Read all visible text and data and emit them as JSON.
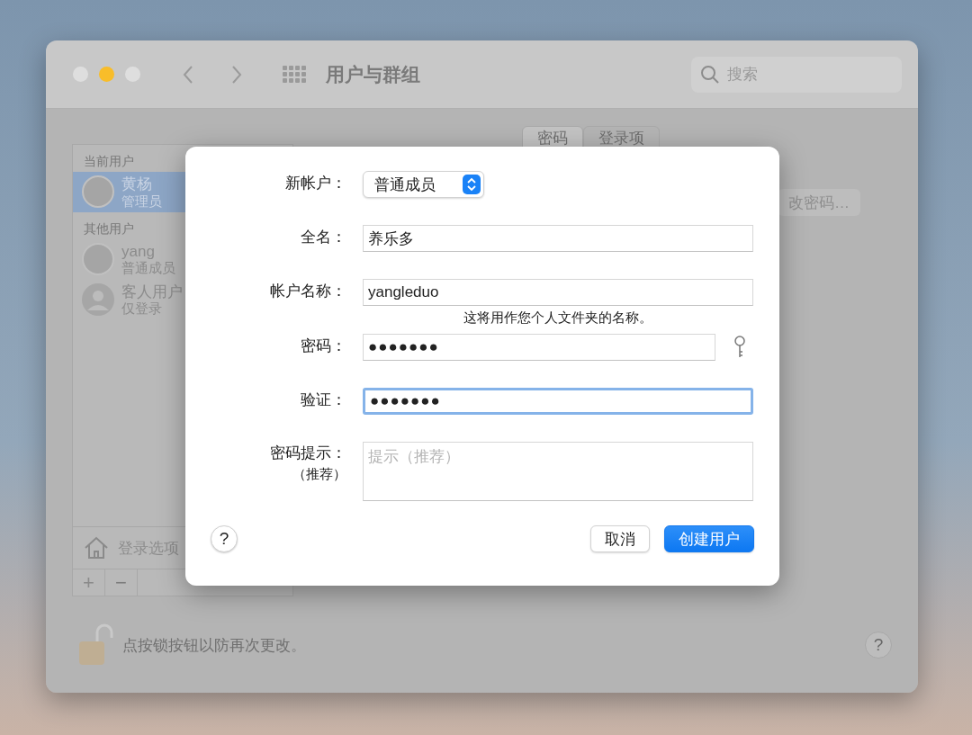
{
  "window": {
    "title": "用户与群组",
    "search": {
      "placeholder": "搜索"
    }
  },
  "sidebar": {
    "sections": [
      {
        "heading": "当前用户",
        "users": [
          {
            "name": "黄杨",
            "role": "管理员",
            "selected": true,
            "kind": "photo"
          }
        ]
      },
      {
        "heading": "其他用户",
        "users": [
          {
            "name": "yang",
            "role": "普通成员",
            "selected": false,
            "kind": "photo"
          },
          {
            "name": "客人用户",
            "role": "仅登录",
            "selected": false,
            "kind": "guest"
          }
        ]
      }
    ],
    "login_options": "登录选项",
    "add_button": "+",
    "remove_button": "−"
  },
  "tabs": [
    {
      "label": "密码",
      "selected": true
    },
    {
      "label": "登录项",
      "selected": false
    }
  ],
  "change_password_button": "改密码…",
  "lock_message": "点按锁按钮以防再次更改。",
  "help_button": "?",
  "dialog": {
    "fields": [
      {
        "kind": "popup",
        "label": "新帐户：",
        "value": "普通成员"
      },
      {
        "kind": "text",
        "label": "全名：",
        "value": "养乐多",
        "focused": false
      },
      {
        "kind": "text",
        "label": "帐户名称：",
        "value": "yangleduo",
        "focused": false,
        "note": "这将用作您个人文件夹的名称。"
      },
      {
        "kind": "password",
        "label": "密码：",
        "value": "●●●●●●●",
        "focused": false
      },
      {
        "kind": "text",
        "label": "验证：",
        "value": "●●●●●●●",
        "focused": true
      },
      {
        "kind": "textarea",
        "label": "密码提示：",
        "sublabel": "（推荐）",
        "placeholder": "提示（推荐）"
      }
    ],
    "help_button": "?",
    "cancel_button": "取消",
    "create_button": "创建用户"
  }
}
